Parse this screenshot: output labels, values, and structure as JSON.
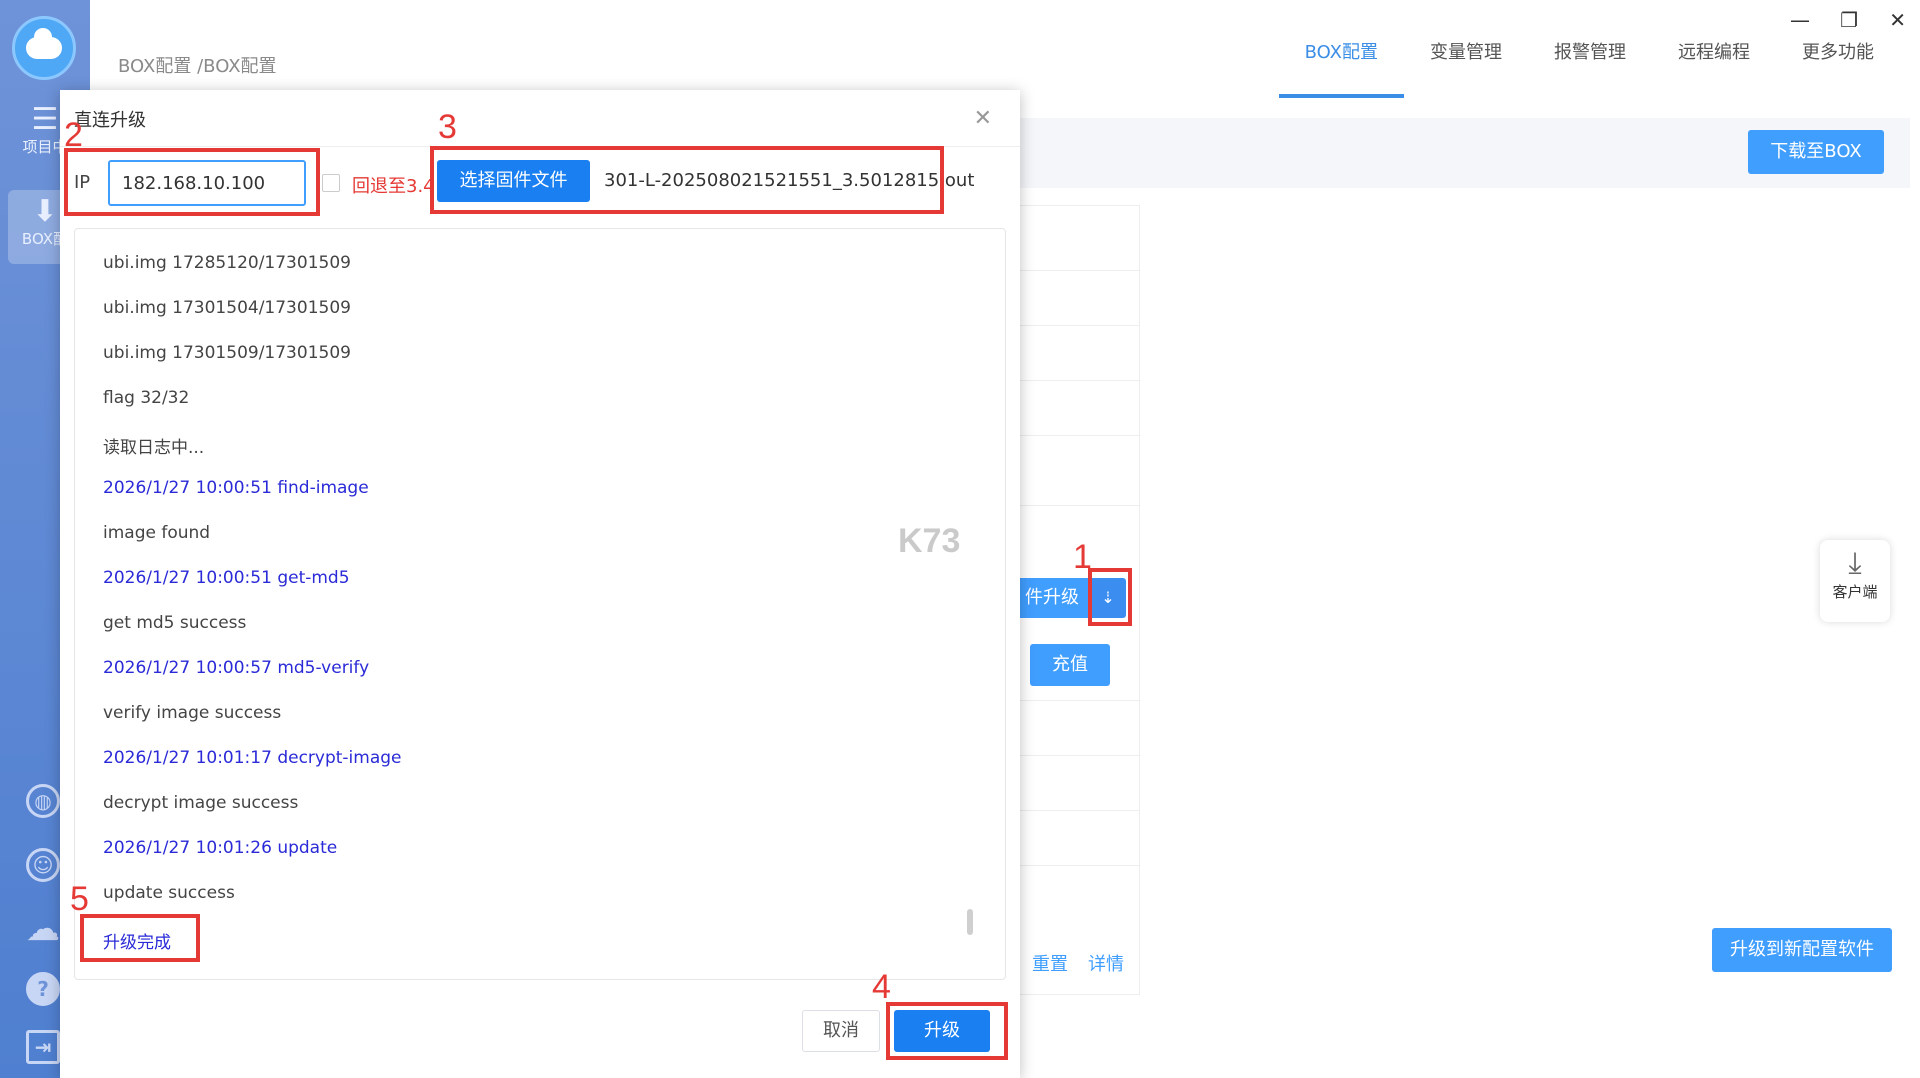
{
  "sidebar": {
    "items": [
      {
        "label": "项目中",
        "icon": "list-icon"
      },
      {
        "label": "BOX配",
        "icon": "download-icon"
      }
    ],
    "bottom_icons": [
      "globe-icon",
      "user-icon",
      "cloud-upload-icon",
      "help-icon",
      "exit-icon"
    ]
  },
  "breadcrumb": "BOX配置 /BOX配置",
  "topnav": [
    "BOX配置",
    "变量管理",
    "报警管理",
    "远程编程",
    "更多功能"
  ],
  "main": {
    "download_to_box": "下载至BOX",
    "firmware_upgrade_partial": "件升级",
    "recharge": "充值",
    "reset": "重置",
    "details": "详情",
    "upgrade_config_software": "升级到新配置软件",
    "client_label": "客户端"
  },
  "dialog": {
    "title": "直连升级",
    "ip_label": "IP",
    "ip_value": "182.168.10.100",
    "rollback_label": "回退至3.4",
    "choose_firmware": "选择固件文件",
    "firmware_file": "301-L-202508021521551_3.5012815.out",
    "log": [
      {
        "text": "ubi.img 17285120/17301509",
        "type": "normal"
      },
      {
        "text": "ubi.img 17301504/17301509",
        "type": "normal"
      },
      {
        "text": "ubi.img 17301509/17301509",
        "type": "normal"
      },
      {
        "text": "flag 32/32",
        "type": "normal"
      },
      {
        "text": "读取日志中...",
        "type": "normal"
      },
      {
        "text": "2026/1/27 10:00:51 find-image",
        "type": "blue"
      },
      {
        "text": "image found",
        "type": "normal"
      },
      {
        "text": "2026/1/27 10:00:51 get-md5",
        "type": "blue"
      },
      {
        "text": "get md5 success",
        "type": "normal"
      },
      {
        "text": "2026/1/27 10:00:57 md5-verify",
        "type": "blue"
      },
      {
        "text": "verify image success",
        "type": "normal"
      },
      {
        "text": "2026/1/27 10:01:17 decrypt-image",
        "type": "blue"
      },
      {
        "text": "decrypt image success",
        "type": "normal"
      },
      {
        "text": "2026/1/27 10:01:26 update",
        "type": "blue"
      },
      {
        "text": "update success",
        "type": "normal"
      },
      {
        "text": "升级完成",
        "type": "blue"
      }
    ],
    "cancel": "取消",
    "upgrade": "升级"
  },
  "annotations": [
    "1",
    "2",
    "3",
    "4",
    "5"
  ],
  "watermark": "K73",
  "colors": {
    "accent": "#409eff",
    "primary_button": "#1a7ff0",
    "annotation": "#e53935",
    "log_blue": "#2a2ad8"
  }
}
